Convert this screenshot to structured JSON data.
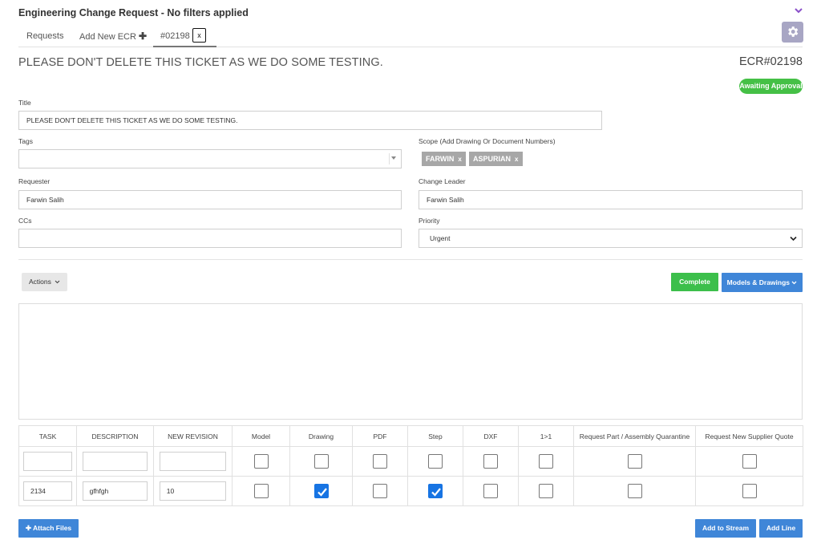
{
  "header": {
    "title": "Engineering Change Request - No filters applied"
  },
  "tabs": [
    {
      "label": "Requests"
    },
    {
      "label": "Add New ECR",
      "icon": "plus-icon",
      "glyph": "✚"
    },
    {
      "label": "#02198",
      "close": "x"
    }
  ],
  "ticket": {
    "heading": "PLEASE DON'T DELETE THIS TICKET AS WE DO SOME TESTING.",
    "number": "ECR#02198",
    "status": "Awaiting Approval",
    "status_color": "#45c046"
  },
  "form": {
    "title_label": "Title",
    "title_value": "PLEASE DON'T DELETE THIS TICKET AS WE DO SOME TESTING.",
    "tags_label": "Tags",
    "tags_value": "",
    "scope_label": "Scope (Add Drawing Or Document Numbers)",
    "scope_chips": [
      {
        "label": "FARWIN",
        "remove": "x"
      },
      {
        "label": "ASPURIAN",
        "remove": "x"
      }
    ],
    "requester_label": "Requester",
    "requester_value": "Farwin Salih",
    "change_leader_label": "Change Leader",
    "change_leader_value": "Farwin Salih",
    "ccs_label": "CCs",
    "ccs_value": "",
    "priority_label": "Priority",
    "priority_value": "Urgent"
  },
  "toolbar": {
    "actions_label": "Actions",
    "complete_label": "Complete",
    "models_label": "Models & Drawings",
    "accent_green": "#3cbf4b",
    "accent_blue": "#3f86d8"
  },
  "table": {
    "columns": [
      "TASK",
      "DESCRIPTION",
      "NEW REVISION",
      "Model",
      "Drawing",
      "PDF",
      "Step",
      "DXF",
      "1>1",
      "Request Part / Assembly Quarantine",
      "Request New Supplier Quote"
    ],
    "rows": [
      {
        "task": "",
        "description": "",
        "new_revision": "",
        "checks": [
          false,
          false,
          false,
          false,
          false,
          false,
          false,
          false
        ]
      },
      {
        "task": "2134",
        "description": "gfhfgh",
        "new_revision": "10",
        "checks": [
          false,
          true,
          false,
          true,
          false,
          false,
          false,
          false
        ]
      }
    ]
  },
  "footer": {
    "attach_label": "Attach Files",
    "attach_glyph": "✚",
    "stream_label": "Add to Stream",
    "addline_label": "Add Line"
  }
}
